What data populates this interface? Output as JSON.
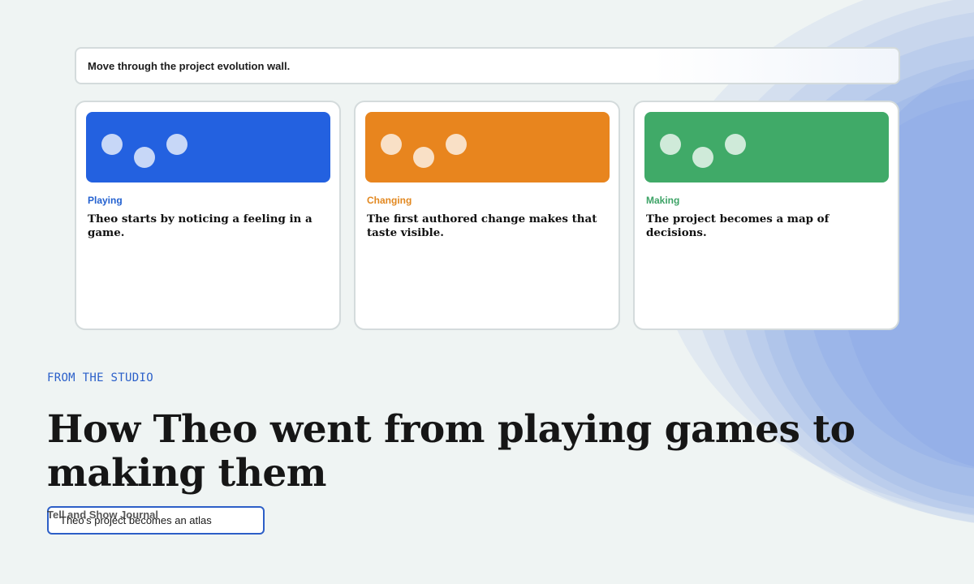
{
  "instruction": {
    "text": "Move through the project evolution wall."
  },
  "cards": [
    {
      "category": "Playing",
      "text": "Theo starts by noticing a feeling in a game.",
      "color": "#2361e0",
      "category_color": "#2361d0"
    },
    {
      "category": "Changing",
      "text": "The first authored change makes that taste visible.",
      "color": "#e8851e",
      "category_color": "#e28820"
    },
    {
      "category": "Making",
      "text": "The project becomes a map of decisions.",
      "color": "#40aa68",
      "category_color": "#3da366"
    }
  ],
  "eyebrow": "FROM THE STUDIO",
  "headline": "How Theo went from playing games to making them",
  "journal": {
    "label": "Tell and Show Journal",
    "pill_text": "Theo's project becomes an atlas"
  },
  "colors": {
    "background": "#eff4f3",
    "accent_blue": "#2d5fc7",
    "art_blue": "#7ea0e6"
  }
}
